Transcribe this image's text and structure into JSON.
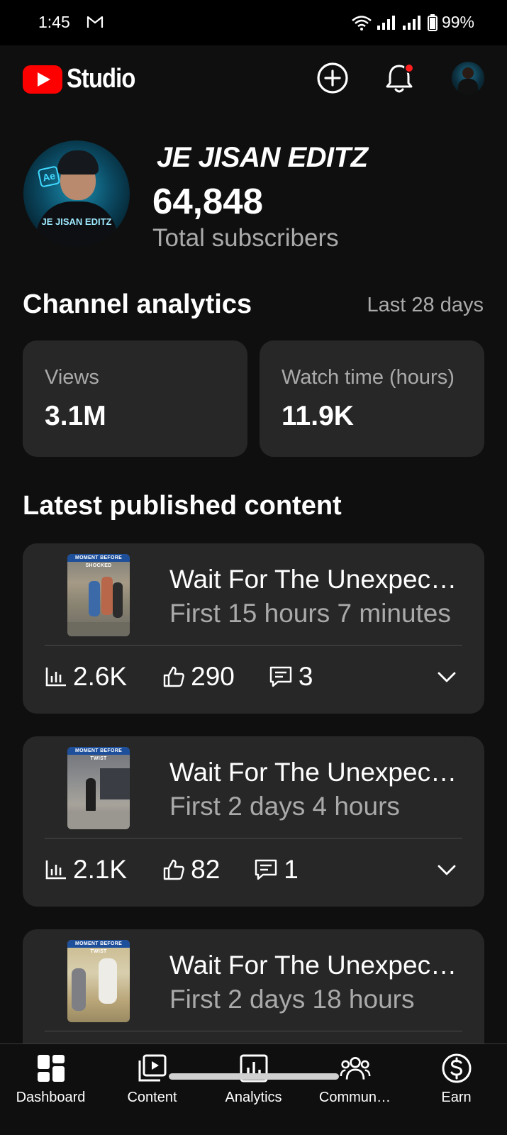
{
  "status_bar": {
    "time": "1:45",
    "battery": "99%"
  },
  "header": {
    "app_name": "Studio",
    "brand_color": "#ff0000",
    "icons": [
      "create-icon",
      "notifications-icon",
      "account-avatar"
    ]
  },
  "channel": {
    "name": "JE JISAN EDITZ",
    "avatar_text": "JE JISAN EDITZ",
    "subscribers": "64,848",
    "subscribers_label": "Total subscribers"
  },
  "analytics": {
    "title": "Channel analytics",
    "range": "Last 28 days",
    "cards": [
      {
        "label": "Views",
        "value": "3.1M"
      },
      {
        "label": "Watch time (hours)",
        "value": "11.9K"
      }
    ]
  },
  "latest": {
    "title": "Latest published content",
    "items": [
      {
        "thumb_label": "MOMENT BEFORE SHOCKED",
        "title": "Wait For The Unexpected",
        "time": "First 15 hours 7 minutes",
        "views": "2.6K",
        "likes": "290",
        "comments": "3"
      },
      {
        "thumb_label": "MOMENT BEFORE TWIST",
        "title": "Wait For The Unexpected",
        "time": "First 2 days 4 hours",
        "views": "2.1K",
        "likes": "82",
        "comments": "1"
      },
      {
        "thumb_label": "MOMENT BEFORE TWIST",
        "title": "Wait For The Unexpected",
        "time": "First 2 days 18 hours"
      }
    ]
  },
  "bottom_nav": [
    {
      "label": "Dashboard",
      "icon": "dashboard-icon",
      "active": true
    },
    {
      "label": "Content",
      "icon": "content-icon"
    },
    {
      "label": "Analytics",
      "icon": "analytics-icon"
    },
    {
      "label": "Commun…",
      "icon": "community-icon"
    },
    {
      "label": "Earn",
      "icon": "earn-icon"
    }
  ]
}
